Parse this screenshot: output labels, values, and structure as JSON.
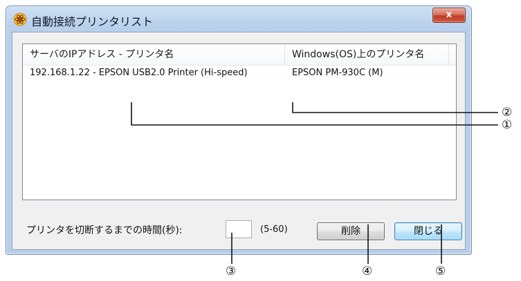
{
  "window": {
    "title": "自動接続プリンタリスト",
    "close_label": "x"
  },
  "list": {
    "headers": [
      "サーバのIPアドレス - プリンタ名",
      "Windows(OS)上のプリンタ名"
    ],
    "rows": [
      [
        "192.168.1.22 - EPSON USB2.0 Printer (Hi-speed)",
        "EPSON PM-930C (M)"
      ]
    ]
  },
  "timeout": {
    "label": "プリンタを切断するまでの時間(秒):",
    "value": "",
    "range": "(5-60)"
  },
  "buttons": {
    "delete_label": "削除",
    "close_label": "閉じる"
  },
  "callouts": [
    "①",
    "②",
    "③",
    "④",
    "⑤"
  ],
  "colors": {
    "title_bar": "#b9d1ec",
    "close_button": "#c13a24",
    "client_bg": "#f0f0f0",
    "focus_button": "#bee6fd"
  }
}
